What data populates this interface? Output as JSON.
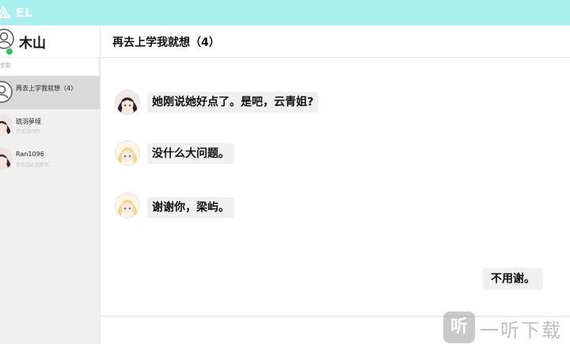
{
  "app": {
    "name": "EL"
  },
  "profile": {
    "name": "木山",
    "status": "online"
  },
  "search": {
    "placeholder": "搜索"
  },
  "contacts": [
    {
      "name": "再去上学我就想（4）",
      "preview": "",
      "active": true
    },
    {
      "name": "琉羽夢境",
      "preview": "是或没同的"
    },
    {
      "name": "Ran1096",
      "preview": "等我到达到那样..."
    }
  ],
  "chat": {
    "title": "再去上学我就想（4）",
    "messages": [
      {
        "side": "left",
        "avatar": "dark-hair-girl-avatar",
        "text": "她刚说她好点了。是吧，云青姐?"
      },
      {
        "side": "left",
        "avatar": "blonde-girl-avatar",
        "text": "没什么大问题。"
      },
      {
        "side": "left",
        "avatar": "blonde-girl-avatar",
        "text": "谢谢你，梁屿。"
      },
      {
        "side": "right",
        "avatar": "",
        "text": "不用谢。"
      }
    ]
  },
  "watermark": {
    "icon": "听",
    "text": "一听下载"
  },
  "colors": {
    "titlebar": "#a8f1ee",
    "online": "#2fc15a",
    "bubble": "#f0f0f0"
  }
}
